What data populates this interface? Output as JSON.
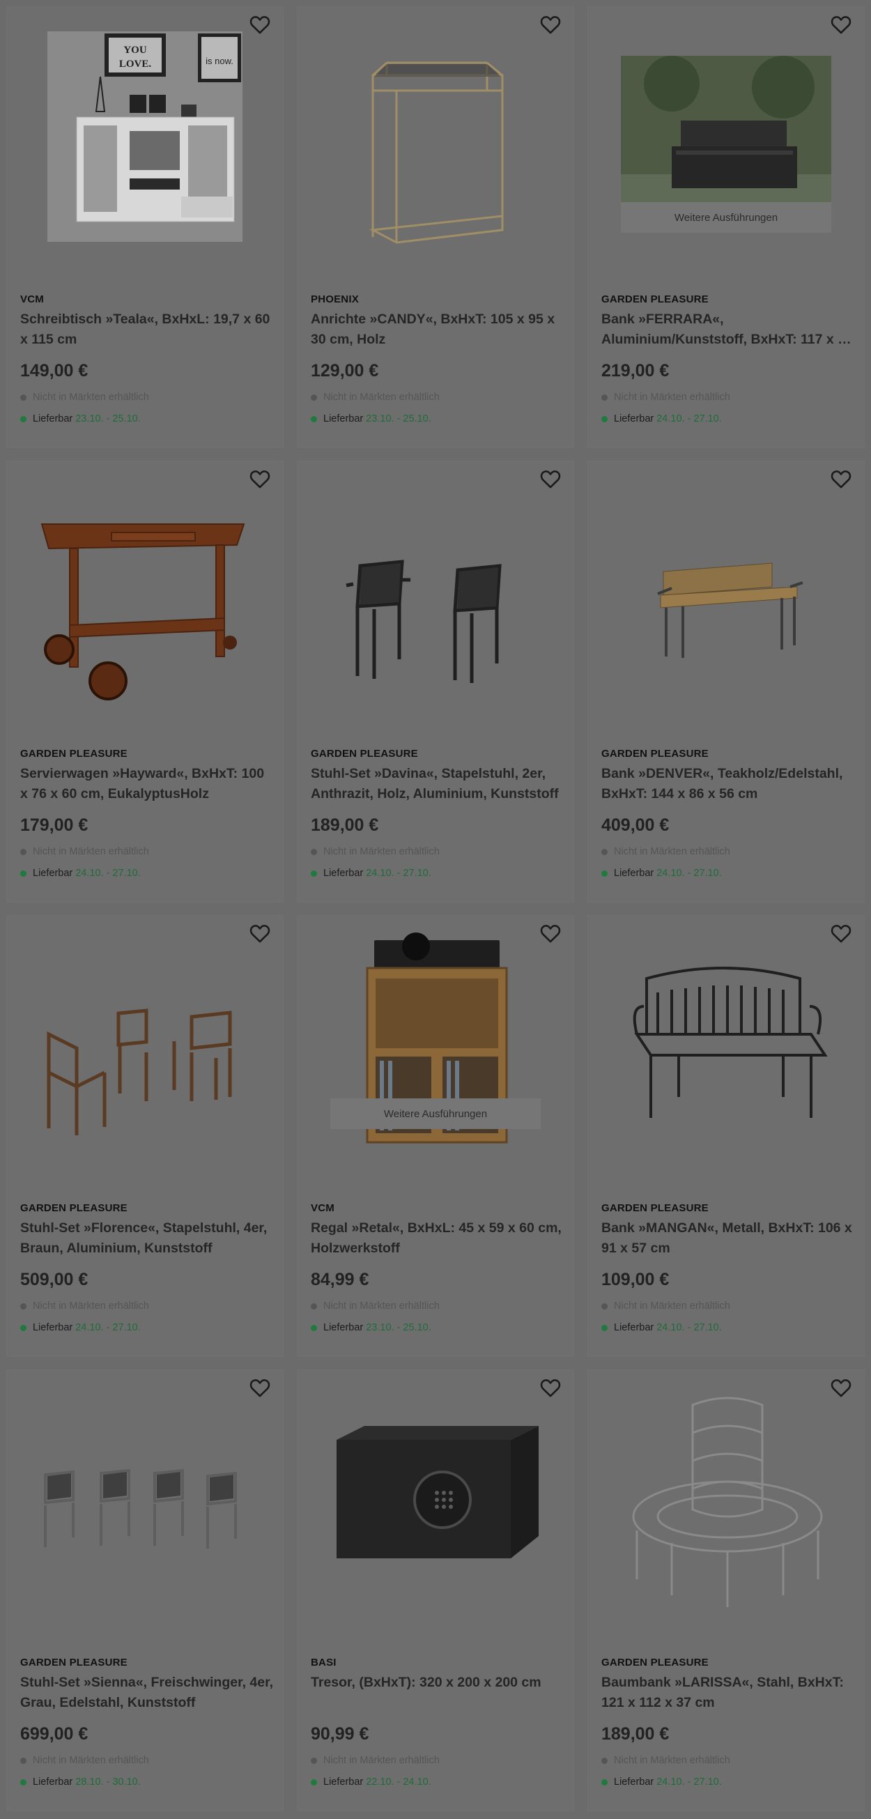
{
  "products": [
    {
      "brand": "VCM",
      "title": "Schreibtisch »Teala«, BxHxL: 19,7 x 60 x 115 cm",
      "price": "149,00 €",
      "store": "Nicht in Märkten erhältlich",
      "delivery_label": "Lieferbar",
      "delivery_date": "23.10. - 25.10.",
      "image_icon": "wall-desk-shelf-image",
      "variants": null
    },
    {
      "brand": "PHOENIX",
      "title": "Anrichte »CANDY«, BxHxT: 105 x 95 x 30 cm, Holz",
      "price": "129,00 €",
      "store": "Nicht in Märkten erhältlich",
      "delivery_label": "Lieferbar",
      "delivery_date": "23.10. - 25.10.",
      "image_icon": "console-table-image",
      "variants": null
    },
    {
      "brand": "GARDEN PLEASURE",
      "title": "Bank »FERRARA«, Aluminium/Kunststoff, BxHxT: 117 x …",
      "price": "219,00 €",
      "store": "Nicht in Märkten erhältlich",
      "delivery_label": "Lieferbar",
      "delivery_date": "24.10. - 27.10.",
      "image_icon": "garden-storage-bench-image",
      "variants": "Weitere Ausführungen"
    },
    {
      "brand": "GARDEN PLEASURE",
      "title": "Servierwagen »Hayward«, BxHxT: 100 x 76 x 60 cm, EukalyptusHolz",
      "price": "179,00 €",
      "store": "Nicht in Märkten erhältlich",
      "delivery_label": "Lieferbar",
      "delivery_date": "24.10. - 27.10.",
      "image_icon": "serving-trolley-image",
      "variants": null
    },
    {
      "brand": "GARDEN PLEASURE",
      "title": "Stuhl-Set »Davina«, Stapelstuhl, 2er, Anthrazit, Holz, Aluminium, Kunststoff",
      "price": "189,00 €",
      "store": "Nicht in Märkten erhältlich",
      "delivery_label": "Lieferbar",
      "delivery_date": "24.10. - 27.10.",
      "image_icon": "two-chairs-image",
      "variants": null
    },
    {
      "brand": "GARDEN PLEASURE",
      "title": "Bank »DENVER«, Teakholz/Edelstahl, BxHxT: 144 x 86 x 56 cm",
      "price": "409,00 €",
      "store": "Nicht in Märkten erhältlich",
      "delivery_label": "Lieferbar",
      "delivery_date": "24.10. - 27.10.",
      "image_icon": "teak-bench-image",
      "variants": null
    },
    {
      "brand": "GARDEN PLEASURE",
      "title": "Stuhl-Set »Florence«, Stapelstuhl, 4er, Braun, Aluminium, Kunststoff",
      "price": "509,00 €",
      "store": "Nicht in Märkten erhältlich",
      "delivery_label": "Lieferbar",
      "delivery_date": "24.10. - 27.10.",
      "image_icon": "three-chairs-image",
      "variants": null
    },
    {
      "brand": "VCM",
      "title": "Regal »Retal«, BxHxL: 45 x 59 x 60 cm, Holzwerkstoff",
      "price": "84,99 €",
      "store": "Nicht in Märkten erhältlich",
      "delivery_label": "Lieferbar",
      "delivery_date": "23.10. - 25.10.",
      "image_icon": "record-shelf-image",
      "variants": "Weitere Ausführungen"
    },
    {
      "brand": "GARDEN PLEASURE",
      "title": "Bank »MANGAN«, Metall, BxHxT: 106 x 91 x 57 cm",
      "price": "109,00 €",
      "store": "Nicht in Märkten erhältlich",
      "delivery_label": "Lieferbar",
      "delivery_date": "24.10. - 27.10.",
      "image_icon": "metal-bench-image",
      "variants": null
    },
    {
      "brand": "GARDEN PLEASURE",
      "title": "Stuhl-Set »Sienna«, Freischwinger, 4er, Grau, Edelstahl, Kunststoff",
      "price": "699,00 €",
      "store": "Nicht in Märkten erhältlich",
      "delivery_label": "Lieferbar",
      "delivery_date": "28.10. - 30.10.",
      "image_icon": "four-chairs-image",
      "variants": null
    },
    {
      "brand": "BASI",
      "title": "Tresor, (BxHxT): 320 x 200 x 200 cm",
      "price": "90,99 €",
      "store": "Nicht in Märkten erhältlich",
      "delivery_label": "Lieferbar",
      "delivery_date": "22.10. - 24.10.",
      "image_icon": "safe-image",
      "variants": null
    },
    {
      "brand": "GARDEN PLEASURE",
      "title": "Baumbank »LARISSA«, Stahl, BxHxT: 121 x 112 x 37 cm",
      "price": "189,00 €",
      "store": "Nicht in Märkten erhältlich",
      "delivery_label": "Lieferbar",
      "delivery_date": "24.10. - 27.10.",
      "image_icon": "tree-bench-image",
      "variants": null
    }
  ],
  "icons": {
    "favorite": "heart-outline-icon",
    "in_store": "grey-dot-icon",
    "delivery": "green-dot-icon"
  },
  "colors": {
    "overlay": "#6b6b6b",
    "delivery_dot": "#1f7a3d",
    "delivery_date": "#1f6b3a"
  }
}
